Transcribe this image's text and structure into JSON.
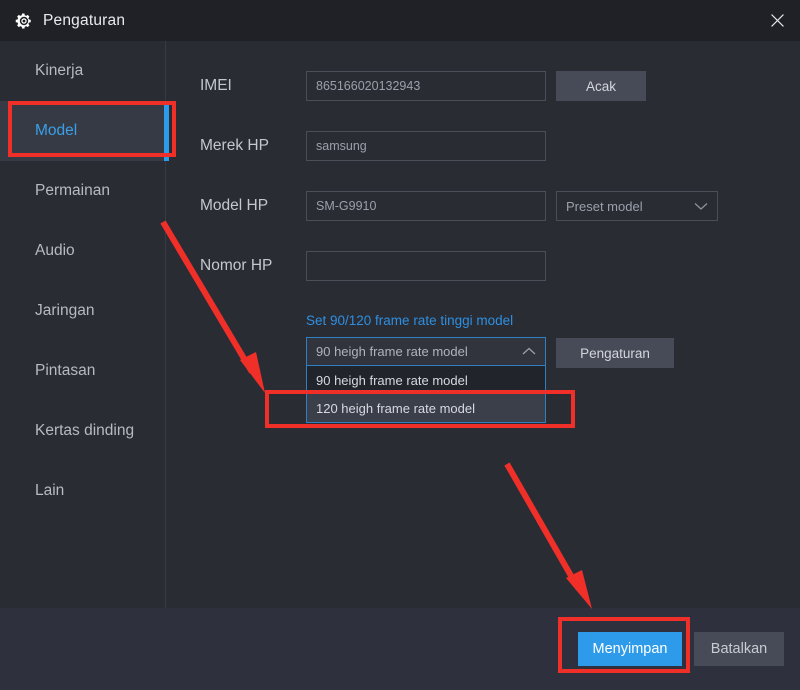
{
  "window": {
    "title": "Pengaturan",
    "gear_icon": "gear-icon",
    "close_icon": "close-icon"
  },
  "sidebar": {
    "items": [
      {
        "label": "Kinerja",
        "active": false
      },
      {
        "label": "Model",
        "active": true
      },
      {
        "label": "Permainan",
        "active": false
      },
      {
        "label": "Audio",
        "active": false
      },
      {
        "label": "Jaringan",
        "active": false
      },
      {
        "label": "Pintasan",
        "active": false
      },
      {
        "label": "Kertas dinding",
        "active": false
      },
      {
        "label": "Lain",
        "active": false
      }
    ]
  },
  "form": {
    "imei": {
      "label": "IMEI",
      "value": "865166020132943",
      "placeholder": "",
      "button": "Acak"
    },
    "brand": {
      "label": "Merek HP",
      "value": "samsung",
      "placeholder": ""
    },
    "model": {
      "label": "Model HP",
      "value": "SM-G9910",
      "placeholder": "",
      "preset_select": "Preset model",
      "preset_chevron": "chevron-down-icon"
    },
    "phone_number": {
      "label": "Nomor HP",
      "value": "",
      "placeholder": ""
    }
  },
  "frame_rate": {
    "link_label": "Set 90/120 frame rate tinggi model",
    "selected": "90 heigh frame rate model",
    "chevron": "chevron-up-icon",
    "options": [
      {
        "label": "90 heigh frame rate model",
        "highlighted": false
      },
      {
        "label": "120 heigh frame rate  model",
        "highlighted": true
      }
    ],
    "settings_button": "Pengaturan"
  },
  "footer": {
    "save_label": "Menyimpan",
    "cancel_label": "Batalkan"
  },
  "colors": {
    "accent_blue": "#2e9bea",
    "annotation_red": "#f03028",
    "window_bg": "#2a2c34",
    "titlebar_bg": "#1f2127",
    "footer_bg": "#2e313d",
    "active_item_bg": "#363a45"
  }
}
